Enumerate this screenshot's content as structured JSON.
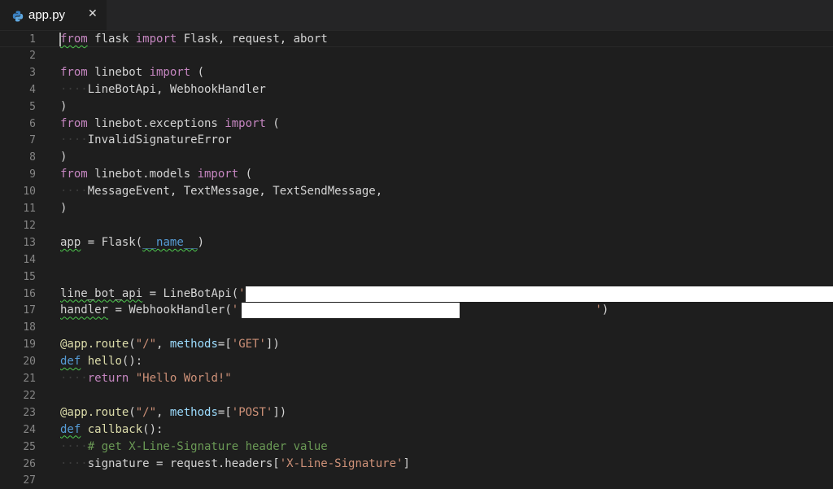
{
  "tab": {
    "label": "app.py",
    "close_glyph": "✕",
    "icon": "python-icon"
  },
  "colors": {
    "keyword": "#c586c0",
    "storage": "#569cd6",
    "string": "#ce9178",
    "function": "#dcdcaa",
    "variable": "#9cdcfe",
    "comment": "#6a9955",
    "text": "#d4d4d4",
    "line_number": "#858585",
    "background": "#1e1e1e"
  },
  "lines": [
    {
      "n": "1",
      "tokens": [
        {
          "t": "from",
          "c": "kw",
          "sq": true
        },
        {
          "t": " flask ",
          "c": "plain"
        },
        {
          "t": "import",
          "c": "kw"
        },
        {
          "t": " Flask, request, abort",
          "c": "plain"
        }
      ]
    },
    {
      "n": "2",
      "tokens": []
    },
    {
      "n": "3",
      "tokens": [
        {
          "t": "from",
          "c": "kw"
        },
        {
          "t": " linebot ",
          "c": "plain"
        },
        {
          "t": "import",
          "c": "kw"
        },
        {
          "t": " (",
          "c": "plain"
        }
      ]
    },
    {
      "n": "4",
      "tokens": [
        {
          "t": "····",
          "c": "ws"
        },
        {
          "t": "LineBotApi, WebhookHandler",
          "c": "plain"
        }
      ]
    },
    {
      "n": "5",
      "tokens": [
        {
          "t": ")",
          "c": "plain"
        }
      ]
    },
    {
      "n": "6",
      "tokens": [
        {
          "t": "from",
          "c": "kw"
        },
        {
          "t": " linebot.exceptions ",
          "c": "plain"
        },
        {
          "t": "import",
          "c": "kw"
        },
        {
          "t": " (",
          "c": "plain"
        }
      ]
    },
    {
      "n": "7",
      "tokens": [
        {
          "t": "····",
          "c": "ws"
        },
        {
          "t": "InvalidSignatureError",
          "c": "plain"
        }
      ]
    },
    {
      "n": "8",
      "tokens": [
        {
          "t": ")",
          "c": "plain"
        }
      ]
    },
    {
      "n": "9",
      "tokens": [
        {
          "t": "from",
          "c": "kw"
        },
        {
          "t": " linebot.models ",
          "c": "plain"
        },
        {
          "t": "import",
          "c": "kw"
        },
        {
          "t": " (",
          "c": "plain"
        }
      ]
    },
    {
      "n": "10",
      "tokens": [
        {
          "t": "····",
          "c": "ws"
        },
        {
          "t": "MessageEvent, TextMessage, TextSendMessage,",
          "c": "plain"
        }
      ]
    },
    {
      "n": "11",
      "tokens": [
        {
          "t": ")",
          "c": "plain"
        }
      ]
    },
    {
      "n": "12",
      "tokens": []
    },
    {
      "n": "13",
      "tokens": [
        {
          "t": "app",
          "c": "plain",
          "sq": true
        },
        {
          "t": " = ",
          "c": "plain"
        },
        {
          "t": "Flask",
          "c": "plain"
        },
        {
          "t": "(",
          "c": "plain"
        },
        {
          "t": "__name__",
          "c": "blue",
          "sq": true
        },
        {
          "t": ")",
          "c": "plain"
        }
      ]
    },
    {
      "n": "14",
      "tokens": []
    },
    {
      "n": "15",
      "tokens": []
    },
    {
      "n": "16",
      "tokens": [
        {
          "t": "line_bot_api",
          "c": "plain",
          "sq": true
        },
        {
          "t": " = ",
          "c": "plain"
        },
        {
          "t": "LineBotApi(",
          "c": "plain"
        },
        {
          "t": "'",
          "c": "str"
        }
      ],
      "redacted": "wide"
    },
    {
      "n": "17",
      "tokens": [
        {
          "t": "handler",
          "c": "plain",
          "sq": true
        },
        {
          "t": " = ",
          "c": "plain"
        },
        {
          "t": "WebhookHandler(",
          "c": "plain"
        },
        {
          "t": "'",
          "c": "str"
        },
        {
          "t": "                                                    ",
          "c": "plain"
        },
        {
          "t": "'",
          "c": "str"
        },
        {
          "t": ")",
          "c": "plain"
        }
      ],
      "redacted": "short"
    },
    {
      "n": "18",
      "tokens": []
    },
    {
      "n": "19",
      "tokens": [
        {
          "t": "@app.route",
          "c": "fn"
        },
        {
          "t": "(",
          "c": "plain"
        },
        {
          "t": "\"/\"",
          "c": "str"
        },
        {
          "t": ", ",
          "c": "plain"
        },
        {
          "t": "methods",
          "c": "var"
        },
        {
          "t": "=[",
          "c": "plain"
        },
        {
          "t": "'GET'",
          "c": "str"
        },
        {
          "t": "])",
          "c": "plain"
        }
      ]
    },
    {
      "n": "20",
      "tokens": [
        {
          "t": "def",
          "c": "blue",
          "sq": true
        },
        {
          "t": " ",
          "c": "plain"
        },
        {
          "t": "hello",
          "c": "fn"
        },
        {
          "t": "():",
          "c": "plain"
        }
      ]
    },
    {
      "n": "21",
      "tokens": [
        {
          "t": "····",
          "c": "ws"
        },
        {
          "t": "return",
          "c": "kw"
        },
        {
          "t": " ",
          "c": "plain"
        },
        {
          "t": "\"Hello World!\"",
          "c": "str"
        }
      ]
    },
    {
      "n": "22",
      "tokens": []
    },
    {
      "n": "23",
      "tokens": [
        {
          "t": "@app.route",
          "c": "fn"
        },
        {
          "t": "(",
          "c": "plain"
        },
        {
          "t": "\"/\"",
          "c": "str"
        },
        {
          "t": ", ",
          "c": "plain"
        },
        {
          "t": "methods",
          "c": "var"
        },
        {
          "t": "=[",
          "c": "plain"
        },
        {
          "t": "'POST'",
          "c": "str"
        },
        {
          "t": "])",
          "c": "plain"
        }
      ]
    },
    {
      "n": "24",
      "tokens": [
        {
          "t": "def",
          "c": "blue",
          "sq": true
        },
        {
          "t": " ",
          "c": "plain"
        },
        {
          "t": "callback",
          "c": "fn"
        },
        {
          "t": "():",
          "c": "plain"
        }
      ]
    },
    {
      "n": "25",
      "tokens": [
        {
          "t": "····",
          "c": "ws"
        },
        {
          "t": "# get X-Line-Signature header value",
          "c": "cmt"
        }
      ]
    },
    {
      "n": "26",
      "tokens": [
        {
          "t": "····",
          "c": "ws"
        },
        {
          "t": "signature",
          "c": "plain"
        },
        {
          "t": " = ",
          "c": "plain"
        },
        {
          "t": "request.headers[",
          "c": "plain"
        },
        {
          "t": "'X-Line-Signature'",
          "c": "str"
        },
        {
          "t": "]",
          "c": "plain"
        }
      ]
    },
    {
      "n": "27",
      "tokens": []
    }
  ]
}
